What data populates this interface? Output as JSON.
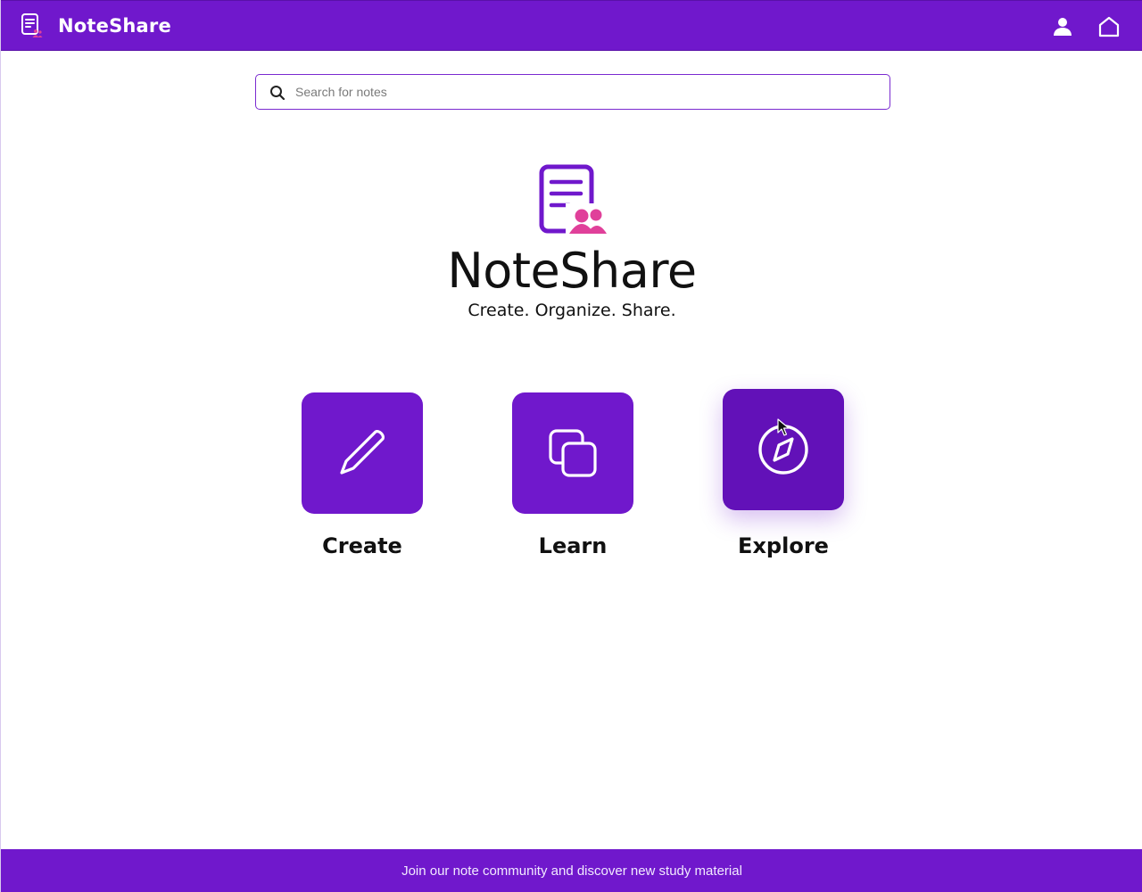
{
  "app": {
    "name": "NoteShare",
    "brand_color": "#7018cc",
    "accent_color": "#e0409a"
  },
  "header": {
    "title": "NoteShare",
    "logo_icon": "note-share-logo-icon",
    "actions": [
      {
        "icon": "user-icon",
        "label": "Profile"
      },
      {
        "icon": "home-icon",
        "label": "Home"
      }
    ]
  },
  "search": {
    "placeholder": "Search for notes",
    "value": "",
    "icon": "search-icon"
  },
  "hero": {
    "title": "NoteShare",
    "tagline": "Create. Organize. Share."
  },
  "actions": [
    {
      "label": "Create",
      "icon": "pencil-icon"
    },
    {
      "label": "Learn",
      "icon": "copy-squares-icon"
    },
    {
      "label": "Explore",
      "icon": "compass-icon",
      "hovered": true
    }
  ],
  "footer": {
    "text": "Join our note community and discover new study material"
  }
}
